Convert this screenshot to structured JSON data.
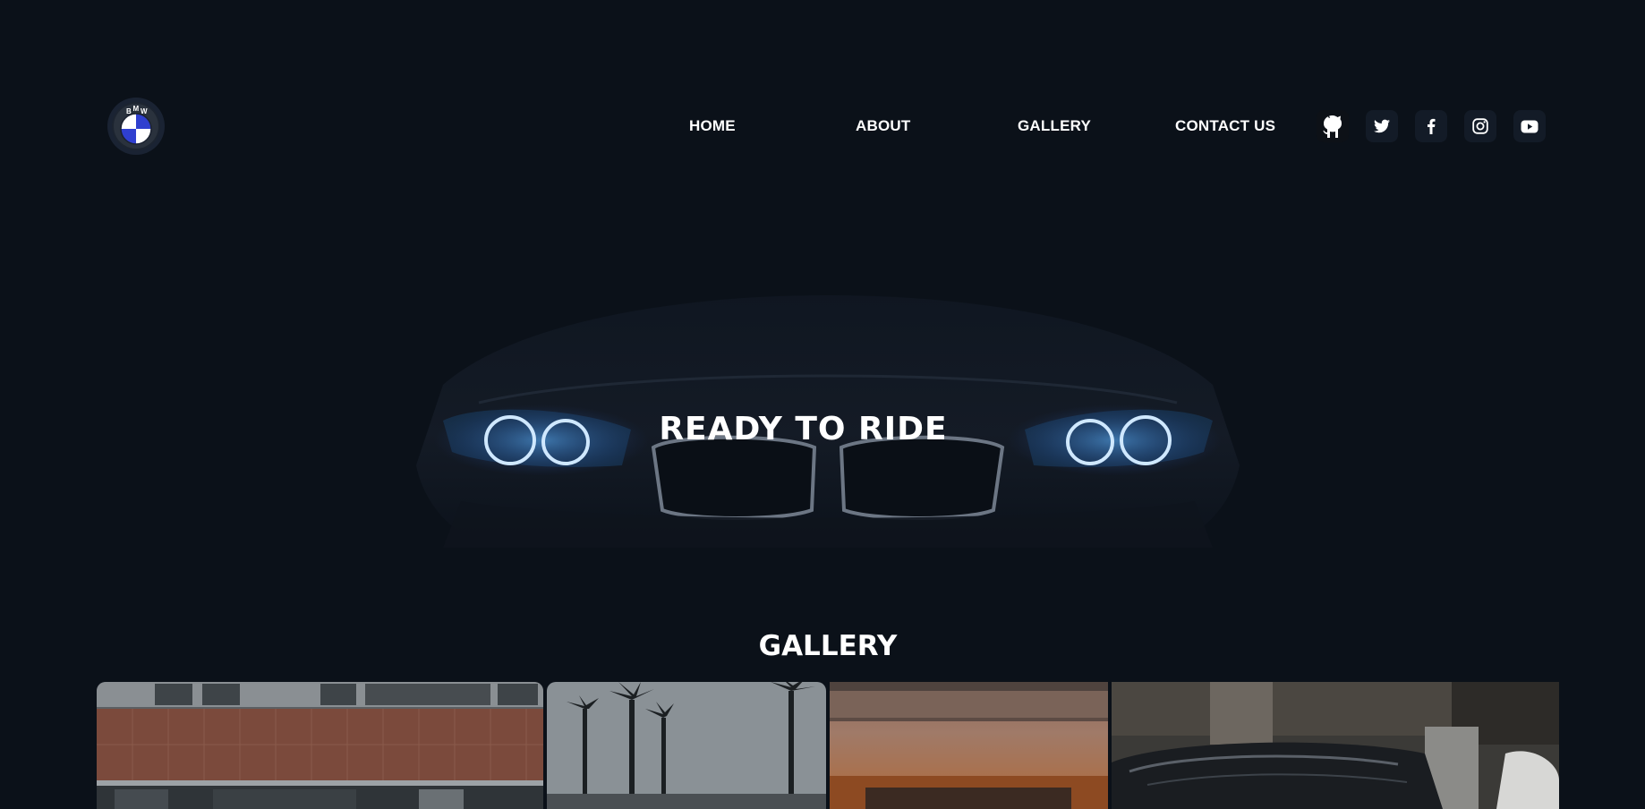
{
  "brand": {
    "logo_icon": "bmw-roundel-icon",
    "logo_letters": [
      "B",
      "M",
      "W"
    ],
    "roundel_blue": "#2f3fcf"
  },
  "nav": {
    "items": [
      {
        "label": "HOME"
      },
      {
        "label": "ABOUT"
      },
      {
        "label": "GALLERY"
      },
      {
        "label": "CONTACT US"
      }
    ]
  },
  "social": [
    {
      "icon": "github-icon"
    },
    {
      "icon": "twitter-icon"
    },
    {
      "icon": "facebook-icon"
    },
    {
      "icon": "instagram-icon"
    },
    {
      "icon": "youtube-icon"
    }
  ],
  "hero": {
    "title": "READY TO RIDE",
    "image": "car-front-headlights-image",
    "headlight_color": "#3a7bd5"
  },
  "gallery": {
    "title": "GALLERY",
    "images": [
      {
        "subject": "building-facade-image"
      },
      {
        "subject": "palm-trees-image"
      },
      {
        "subject": "orange-wall-image"
      },
      {
        "subject": "car-roof-image"
      }
    ]
  },
  "colors": {
    "background": "#0b1119",
    "text": "#ffffff",
    "icon_button": "#131b27"
  }
}
